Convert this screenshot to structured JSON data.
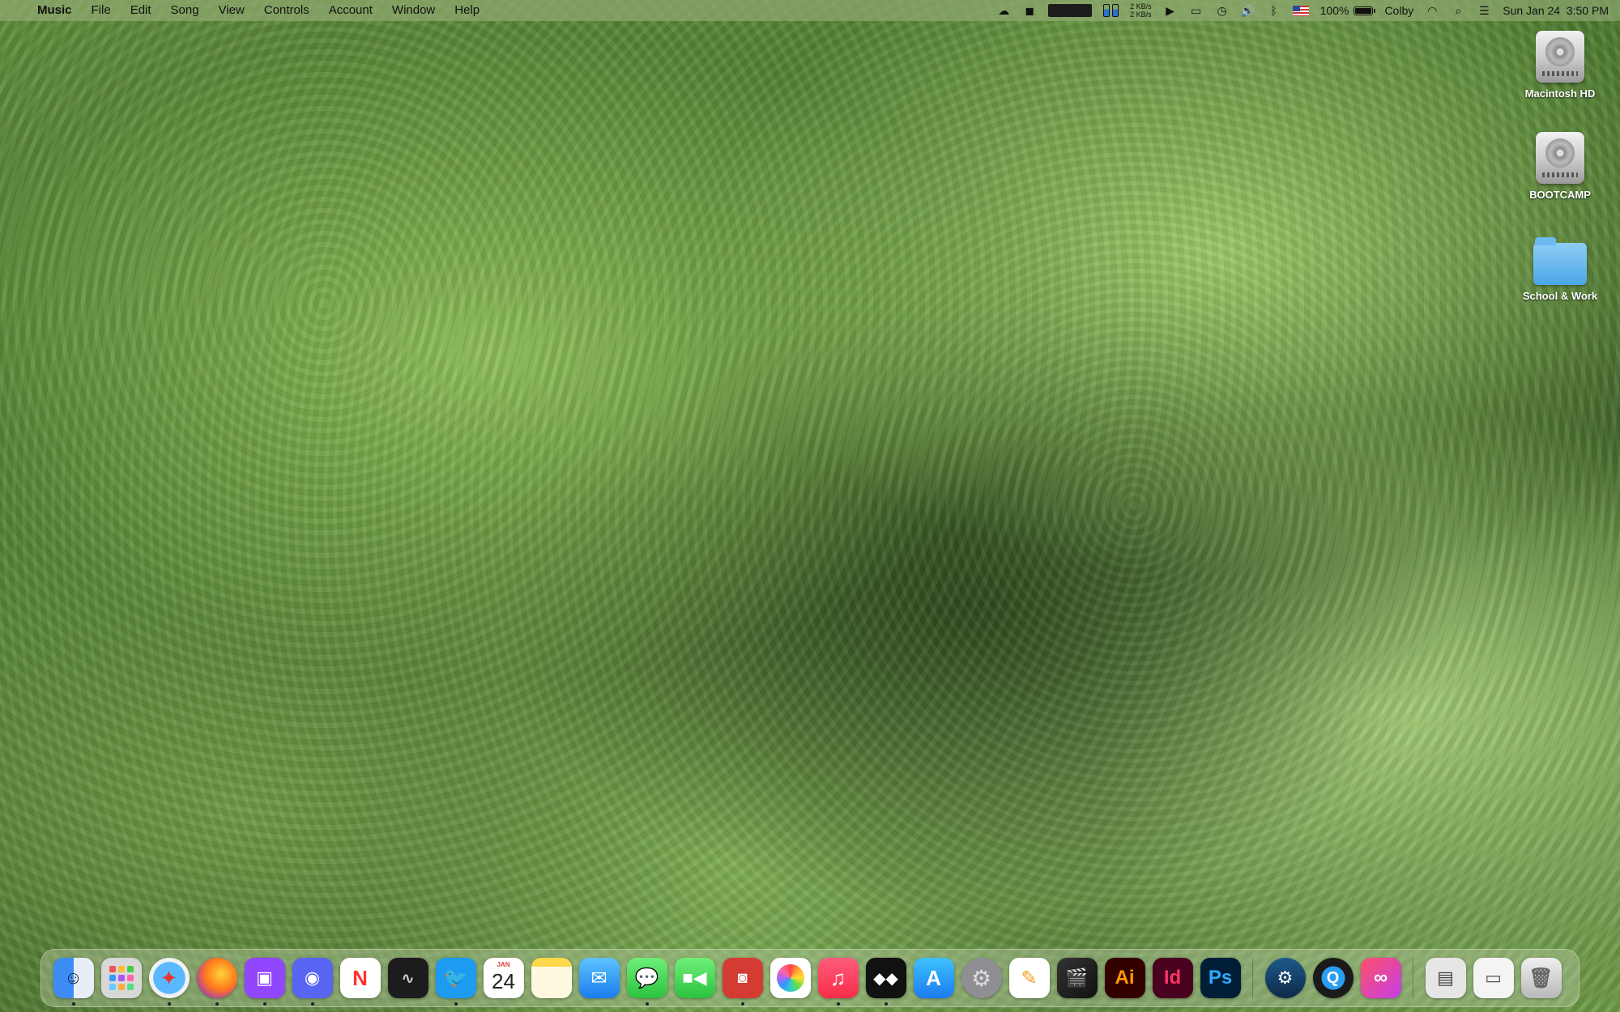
{
  "menubar": {
    "apple_glyph": "",
    "app_name": "Music",
    "menus": [
      "File",
      "Edit",
      "Song",
      "View",
      "Controls",
      "Account",
      "Window",
      "Help"
    ],
    "net_up": "2 KB/s",
    "net_down": "2 KB/s",
    "battery_percent": "100%",
    "battery_level": 1.0,
    "user_name": "Colby",
    "clock": "Sun Jan 24  3:50 PM"
  },
  "desktop": {
    "items": [
      {
        "label": "Macintosh HD",
        "kind": "disk"
      },
      {
        "label": "BOOTCAMP",
        "kind": "disk"
      },
      {
        "label": "School & Work",
        "kind": "folder"
      }
    ]
  },
  "dock": {
    "calendar_month": "JAN",
    "calendar_day": "24",
    "illustrator_label": "Ai",
    "indesign_label": "Id",
    "photoshop_label": "Ps",
    "colors": {
      "finder": "#3d8df5",
      "firefox": "#ff7a1a",
      "twitch": "#9146ff",
      "discord": "#5865f2",
      "twitter": "#1d9bf0",
      "music": "#fa2d48"
    }
  }
}
